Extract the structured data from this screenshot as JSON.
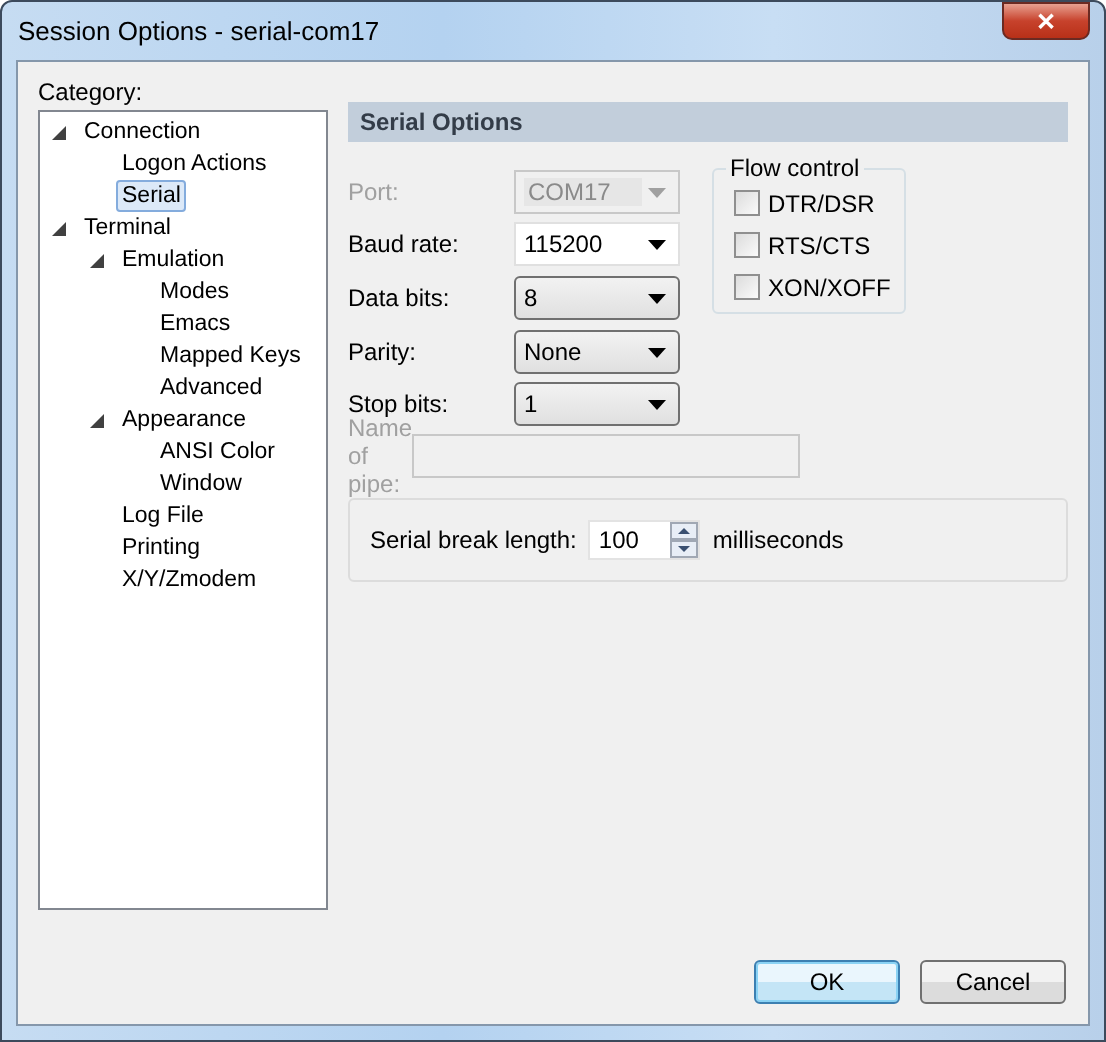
{
  "window": {
    "title": "Session Options - serial-com17",
    "close_button": "✕"
  },
  "category_label": "Category:",
  "tree": [
    {
      "label": "Connection",
      "expanded": true,
      "selected": false,
      "children": [
        {
          "label": "Logon Actions",
          "selected": false
        },
        {
          "label": "Serial",
          "selected": true
        }
      ]
    },
    {
      "label": "Terminal",
      "expanded": true,
      "selected": false,
      "children": [
        {
          "label": "Emulation",
          "expanded": true,
          "selected": false,
          "children": [
            {
              "label": "Modes",
              "selected": false
            },
            {
              "label": "Emacs",
              "selected": false
            },
            {
              "label": "Mapped Keys",
              "selected": false
            },
            {
              "label": "Advanced",
              "selected": false
            }
          ]
        },
        {
          "label": "Appearance",
          "expanded": true,
          "selected": false,
          "children": [
            {
              "label": "ANSI Color",
              "selected": false
            },
            {
              "label": "Window",
              "selected": false
            }
          ]
        },
        {
          "label": "Log File",
          "selected": false
        },
        {
          "label": "Printing",
          "selected": false
        },
        {
          "label": "X/Y/Zmodem",
          "selected": false
        }
      ]
    }
  ],
  "section_title": "Serial Options",
  "fields": [
    {
      "label": "Port:",
      "kind": "combo",
      "value": "COM17",
      "disabled": true
    },
    {
      "label": "Baud rate:",
      "kind": "editcombo",
      "value": "115200",
      "disabled": false
    },
    {
      "label": "Data bits:",
      "kind": "combo",
      "value": "8",
      "disabled": false
    },
    {
      "label": "Parity:",
      "kind": "combo",
      "value": "None",
      "disabled": false
    },
    {
      "label": "Stop bits:",
      "kind": "combo",
      "value": "1",
      "disabled": false
    },
    {
      "label": "Name of pipe:",
      "kind": "text",
      "disabled": true
    }
  ],
  "flow_control": {
    "title": "Flow control",
    "options": [
      {
        "label": "DTR/DSR",
        "checked": false
      },
      {
        "label": "RTS/CTS",
        "checked": false
      },
      {
        "label": "XON/XOFF",
        "checked": false
      }
    ]
  },
  "serial_break": {
    "label": "Serial break length:",
    "value": "100",
    "unit": "milliseconds"
  },
  "buttons": [
    {
      "label": "OK",
      "default": true
    },
    {
      "label": "Cancel",
      "default": false
    }
  ]
}
